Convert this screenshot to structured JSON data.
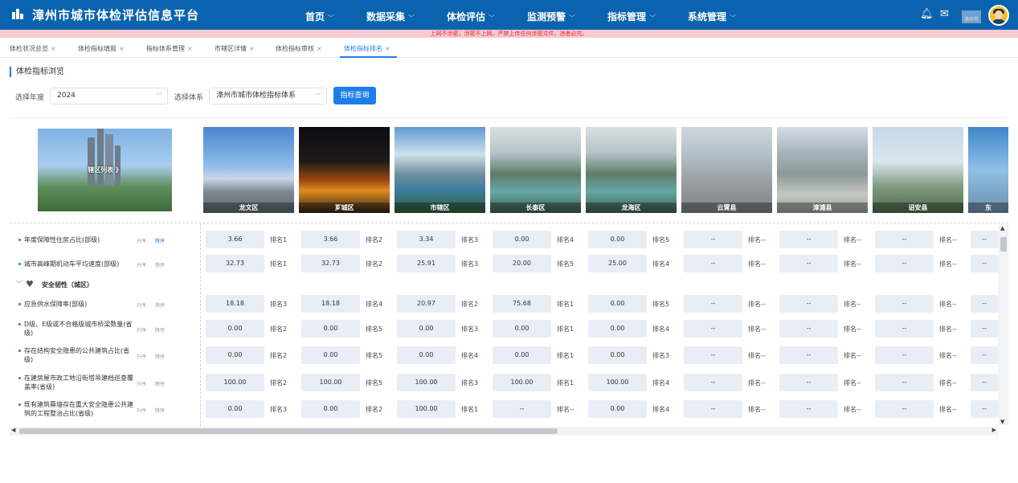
{
  "header": {
    "title": "漳州市城市体检评估信息平台",
    "nav": [
      "首页",
      "数据采集",
      "体检评估",
      "监测预警",
      "指标管理",
      "系统管理"
    ],
    "user_name": "漳州市"
  },
  "notice": "上网不涉密，涉密不上网，严禁上传任何涉密文件，违者必究。",
  "tabs": [
    "体检状况总览",
    "体检指标填报",
    "指标体系管理",
    "市辖区详情",
    "体检指标审核",
    "体检指标排名"
  ],
  "active_tab": "体检指标排名",
  "section_title": "体检指标浏览",
  "filters": {
    "year_label": "选择年度",
    "year_value": "2024",
    "system_label": "选择体系",
    "system_value": "漳州市城市体检指标体系",
    "query_button": "指标查询"
  },
  "district_list_label": "辖区列表 》",
  "districts": [
    "龙文区",
    "芗城区",
    "市辖区",
    "长泰区",
    "龙海区",
    "云霄县",
    "漳浦县",
    "诏安县",
    "东"
  ],
  "sort": {
    "asc": "升序",
    "desc": "降序"
  },
  "category": "安全韧性（城区）",
  "rows": [
    {
      "name": "年度保障性住房占比(部级)",
      "cells": [
        [
          "3.66",
          "排名1"
        ],
        [
          "3.66",
          "排名2"
        ],
        [
          "3.34",
          "排名3"
        ],
        [
          "0.00",
          "排名4"
        ],
        [
          "0.00",
          "排名5"
        ],
        [
          "--",
          "排名--"
        ],
        [
          "--",
          "排名--"
        ],
        [
          "--",
          "排名--"
        ],
        [
          "--",
          ""
        ]
      ]
    },
    {
      "name": "城市高峰期机动车平均速度(部级)",
      "cells": [
        [
          "32.73",
          "排名1"
        ],
        [
          "32.73",
          "排名2"
        ],
        [
          "25.91",
          "排名3"
        ],
        [
          "20.00",
          "排名5"
        ],
        [
          "25.00",
          "排名4"
        ],
        [
          "--",
          "排名--"
        ],
        [
          "--",
          "排名--"
        ],
        [
          "--",
          "排名--"
        ],
        [
          "--",
          ""
        ]
      ]
    },
    {
      "name": "应急供水保障率(部级)",
      "cells": [
        [
          "18.18",
          "排名3"
        ],
        [
          "18.18",
          "排名4"
        ],
        [
          "20.97",
          "排名2"
        ],
        [
          "75.68",
          "排名1"
        ],
        [
          "0.00",
          "排名5"
        ],
        [
          "--",
          "排名--"
        ],
        [
          "--",
          "排名--"
        ],
        [
          "--",
          "排名--"
        ],
        [
          "--",
          ""
        ]
      ]
    },
    {
      "name": "D级、E级或不合格级城市桥梁数量(省级)",
      "cells": [
        [
          "0.00",
          "排名2"
        ],
        [
          "0.00",
          "排名5"
        ],
        [
          "0.00",
          "排名3"
        ],
        [
          "0.00",
          "排名1"
        ],
        [
          "0.00",
          "排名4"
        ],
        [
          "--",
          "排名--"
        ],
        [
          "--",
          "排名--"
        ],
        [
          "--",
          "排名--"
        ],
        [
          "--",
          ""
        ]
      ]
    },
    {
      "name": "存在结构安全隐患的公共建筑占比(省级)",
      "cells": [
        [
          "0.00",
          "排名2"
        ],
        [
          "0.00",
          "排名5"
        ],
        [
          "0.00",
          "排名4"
        ],
        [
          "0.00",
          "排名1"
        ],
        [
          "0.00",
          "排名3"
        ],
        [
          "--",
          "排名--"
        ],
        [
          "--",
          "排名--"
        ],
        [
          "--",
          "排名--"
        ],
        [
          "--",
          ""
        ]
      ]
    },
    {
      "name": "在建房屋市政工地沿街塔吊建档巡查覆盖率(省级)",
      "cells": [
        [
          "100.00",
          "排名2"
        ],
        [
          "100.00",
          "排名5"
        ],
        [
          "100.00",
          "排名3"
        ],
        [
          "100.00",
          "排名1"
        ],
        [
          "100.00",
          "排名4"
        ],
        [
          "--",
          "排名--"
        ],
        [
          "--",
          "排名--"
        ],
        [
          "--",
          "排名--"
        ],
        [
          "--",
          ""
        ]
      ]
    },
    {
      "name": "既有建筑幕墙存在重大安全隐患公共建筑的工程整治占比(省级)",
      "cells": [
        [
          "0.00",
          "排名3"
        ],
        [
          "0.00",
          "排名2"
        ],
        [
          "100.00",
          "排名1"
        ],
        [
          "--",
          "排名--"
        ],
        [
          "0.00",
          "排名4"
        ],
        [
          "--",
          "排名--"
        ],
        [
          "--",
          "排名--"
        ],
        [
          "--",
          "排名--"
        ],
        [
          "--",
          ""
        ]
      ]
    }
  ]
}
